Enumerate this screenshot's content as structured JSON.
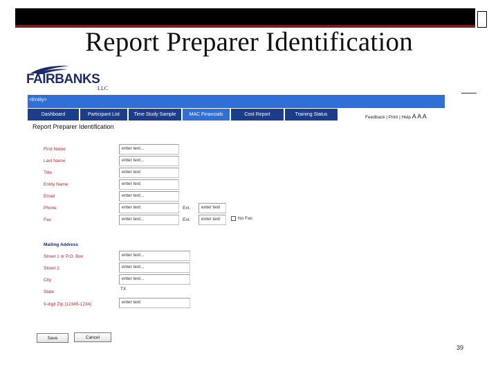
{
  "slide": {
    "title": "Report Preparer Identification",
    "page_number": "39"
  },
  "logo": {
    "text": "FAIRBANKS",
    "sub": "LLC"
  },
  "entity_bar": {
    "label": "<Entity>"
  },
  "nav": {
    "tabs": [
      {
        "label": "Dashboard",
        "active": false
      },
      {
        "label": "Participant List",
        "active": false
      },
      {
        "label": "Time Study Sample",
        "active": false
      },
      {
        "label": "MAC Financials",
        "active": true
      },
      {
        "label": "Cost Report",
        "active": false
      },
      {
        "label": "Training Status",
        "active": false
      }
    ]
  },
  "utility": {
    "feedback": "Feedback",
    "sep1": "|",
    "print": "Print",
    "sep2": "|",
    "help": "Help",
    "text_size": "A A A"
  },
  "form": {
    "heading": "Report Preparer Identification",
    "fields": {
      "first_name": {
        "label": "First Name",
        "value": "enter text..."
      },
      "last_name": {
        "label": "Last Name",
        "value": "enter text..."
      },
      "title": {
        "label": "Title",
        "value": "enter text"
      },
      "entity_name": {
        "label": "Entity Name",
        "value": "enter text"
      },
      "email": {
        "label": "Email",
        "value": "enter text..."
      },
      "phone": {
        "label": "Phone",
        "value": "enter text",
        "ext_label": "Ext.",
        "ext_value": "enter text"
      },
      "fax": {
        "label": "Fax",
        "value": "enter text...",
        "ext_label": "Ext.",
        "ext_value": "enter text",
        "no_fax_label": "No Fax"
      }
    },
    "mailing": {
      "heading": "Mailing Address",
      "street1": {
        "label": "Street 1 or P.O. Box",
        "value": "enter text..."
      },
      "street2": {
        "label": "Street 2",
        "value": "enter text..."
      },
      "city": {
        "label": "City",
        "value": "enter text..."
      },
      "state": {
        "label": "State",
        "value": "TX"
      },
      "zip": {
        "label": "9-digit Zip (12345-1234)",
        "value": "enter text"
      }
    },
    "buttons": {
      "save": "Save",
      "cancel": "Cancel"
    }
  },
  "colors": {
    "entity_bar": "#2f6fd6",
    "nav_tab": "#1c3e8a",
    "label_red": "#c0262c",
    "logo_navy": "#1a2a6e"
  }
}
